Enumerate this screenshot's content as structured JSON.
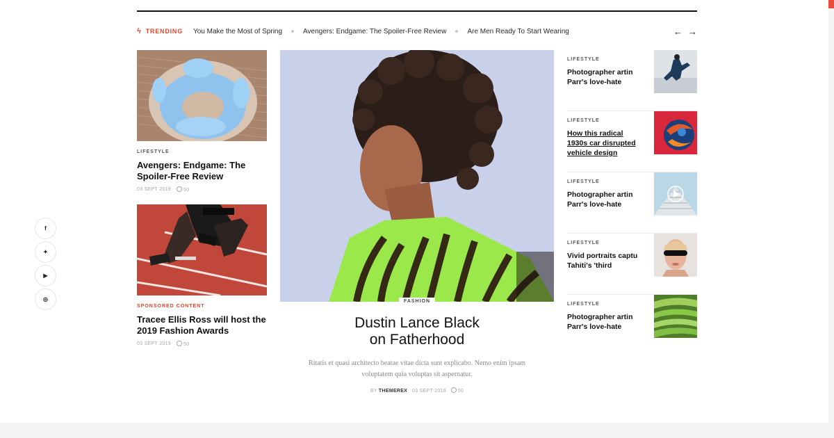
{
  "trending": {
    "label": "TRENDING",
    "items": [
      "You Make the Most of Spring",
      "Avengers: Endgame: The Spoiler-Free Review",
      "Are Men Ready To Start Wearing"
    ],
    "prev_label": "←",
    "next_label": "→"
  },
  "social": {
    "items": [
      {
        "name": "facebook",
        "glyph": "f"
      },
      {
        "name": "twitter",
        "glyph": "✦"
      },
      {
        "name": "youtube",
        "glyph": "▶"
      },
      {
        "name": "instagram",
        "glyph": "◎"
      }
    ]
  },
  "left": {
    "cards": [
      {
        "category": "LIFESTYLE",
        "title": "Avengers: Endgame: The Spoiler-Free Review",
        "date": "03 SEPT 2019",
        "comments": "50"
      },
      {
        "category": "SPONSORED CONTENT",
        "title": "Tracee Ellis Ross will host the 2019 Fashion Awards",
        "date": "03 SEPT 2019",
        "comments": "50"
      }
    ]
  },
  "hero": {
    "tag": "FASHION",
    "title_line1": "Dustin Lance Black",
    "title_line2": "on Fatherhood",
    "excerpt_line1": "Ritatis et quasi architecto beatae vitae dicta sunt explicabo. Nemo enim ipsam",
    "excerpt_line2": "voluptatem quia voluptas sit aspernatur.",
    "by": "BY",
    "author": "THEMEREX",
    "date": "03 SEPT 2019",
    "comments": "50"
  },
  "right": {
    "items": [
      {
        "category": "LIFESTYLE",
        "title": "Photographer artin Parr's love-hate"
      },
      {
        "category": "LIFESTYLE",
        "title": "How this radical 1930s car disrupted vehicle design"
      },
      {
        "category": "LIFESTYLE",
        "title": "Photographer artin Parr's love-hate"
      },
      {
        "category": "LIFESTYLE",
        "title": "Vivid portraits captu Tahiti's 'third"
      },
      {
        "category": "LIFESTYLE",
        "title": "Photographer artin Parr's love-hate"
      }
    ]
  },
  "colors": {
    "accent": "#e0442a",
    "text": "#111111",
    "muted": "#a6a6a6"
  }
}
